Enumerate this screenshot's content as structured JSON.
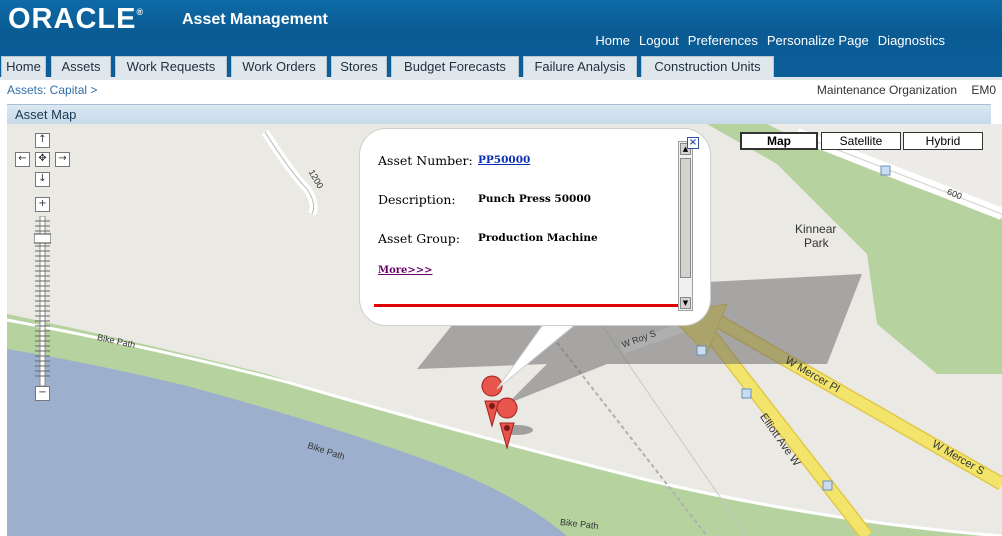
{
  "header": {
    "logo": "ORACLE",
    "app_title": "Asset Management",
    "links": [
      "Home",
      "Logout",
      "Preferences",
      "Personalize Page",
      "Diagnostics"
    ]
  },
  "tabs": [
    "Home",
    "Assets",
    "Work Requests",
    "Work Orders",
    "Stores",
    "Budget Forecasts",
    "Failure Analysis",
    "Construction Units"
  ],
  "breadcrumb": "Assets: Capital  >",
  "org": {
    "label": "Maintenance Organization",
    "value": "EM0"
  },
  "section_title": "Asset Map",
  "map": {
    "types": [
      "Map",
      "Satellite",
      "Hybrid"
    ],
    "active_type": "Map",
    "labels": {
      "kinnear": "Kinnear",
      "park": "Park",
      "bike_path": "Bike Path",
      "mercer_pl": "W Mercer Pl",
      "mercer_st": "W Mercer S",
      "elliott": "Elliott Ave W",
      "roy": "W Roy S",
      "n1200": "1200",
      "n600": "600"
    },
    "controls": {
      "up": "↑",
      "down": "↓",
      "left": "←",
      "right": "→",
      "center": "✥",
      "zoom_in": "+",
      "zoom_out": "−"
    }
  },
  "info_window": {
    "asset_number_label": "Asset Number:",
    "asset_number": "PP50000",
    "description_label": "Description:",
    "description": "Punch Press 50000",
    "asset_group_label": "Asset Group:",
    "asset_group": "Production Machine",
    "more_link": "More>>>",
    "close": "×"
  },
  "colors": {
    "header_blue": "#0b5e98",
    "water": "#9cb0ce",
    "park_green": "#b5d29f",
    "road_yellow": "#f3e56b",
    "marker": "#e8554a"
  }
}
